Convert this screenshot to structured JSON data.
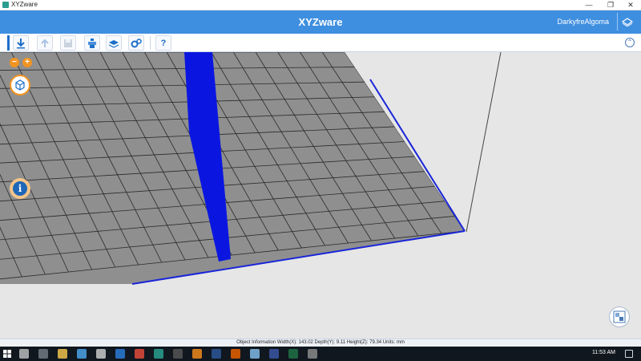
{
  "window": {
    "title": "XYZware",
    "minimize_glyph": "—",
    "restore_glyph": "❐",
    "close_glyph": "✕"
  },
  "header": {
    "app_name": "XYZware",
    "user_name": "DarkyfreAlgoma",
    "logo_icon": "xyz-logo-icon"
  },
  "toolbar": {
    "buttons": [
      {
        "name": "import-icon"
      },
      {
        "name": "export-icon"
      },
      {
        "name": "save-icon"
      },
      {
        "name": "print-icon"
      },
      {
        "name": "layers-icon"
      },
      {
        "name": "settings-icon"
      },
      {
        "name": "help-icon",
        "label": "?"
      }
    ],
    "collapse_glyph": "⌃"
  },
  "viewport": {
    "zoom_out_label": "−",
    "zoom_in_label": "+",
    "info_label": "i",
    "model_color": "#0a16e0",
    "grid_fill": "#8f8f8f",
    "background": "#e6e6e6"
  },
  "status": {
    "text": "Object Information  Width(X): 143.02  Depth(Y): 9.11  Height(Z): 79.34   Units: mm"
  },
  "taskbar": {
    "clock": "11:53 AM",
    "apps": [
      "search-icon",
      "task-view-icon",
      "file-explorer-icon",
      "store-icon",
      "media-icon",
      "edge-icon",
      "chrome-icon",
      "xyzware-icon",
      "terminal-icon",
      "vlc-icon",
      "word-icon",
      "firefox-icon",
      "notepad-icon",
      "visio-icon",
      "excel-icon",
      "photos-icon"
    ]
  },
  "colors": {
    "header_blue": "#3f8fe0",
    "accent_orange": "#f29423"
  }
}
